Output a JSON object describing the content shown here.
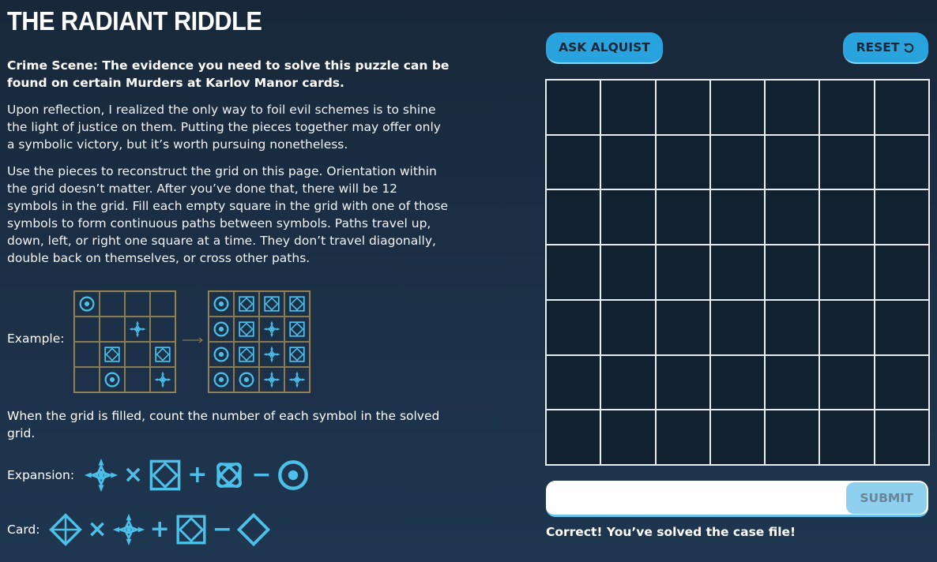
{
  "title": "THE RADIANT RIDDLE",
  "lead": "Crime Scene: The evidence you need to solve this puzzle can be found on certain Murders at Karlov Manor cards.",
  "paragraphs": [
    "Upon reflection, I realized the only way to foil evil schemes is to shine the light of justice on them. Putting the pieces together may offer only a symbolic victory, but it’s worth pursuing nonetheless.",
    "Use the pieces to reconstruct the grid on this page. Orientation within the grid doesn’t matter. After you’ve done that, there will be 12 symbols in the grid. Fill each empty square in the grid with one of those symbols to form continuous paths between symbols. Paths travel up, down, left, or right one square at a time. They don’t travel diagonally, double back on themselves, or cross other paths."
  ],
  "example": {
    "label": "Example:",
    "before": [
      [
        "dot-circle-icon",
        "",
        "",
        ""
      ],
      [
        "",
        "",
        "compass-star-icon",
        ""
      ],
      [
        "",
        "framed-diamond-icon",
        "",
        "framed-diamond-icon"
      ],
      [
        "",
        "dot-circle-icon",
        "",
        "compass-star-icon"
      ]
    ],
    "after": [
      [
        "dot-circle-icon",
        "framed-diamond-icon",
        "framed-diamond-icon",
        "framed-diamond-icon"
      ],
      [
        "dot-circle-icon",
        "framed-diamond-icon",
        "compass-star-icon",
        "framed-diamond-icon"
      ],
      [
        "dot-circle-icon",
        "framed-diamond-icon",
        "compass-star-icon",
        "framed-diamond-icon"
      ],
      [
        "dot-circle-icon",
        "dot-circle-icon",
        "compass-star-icon",
        "compass-star-icon"
      ]
    ]
  },
  "count_text": "When the grid is filled, count the number of each symbol in the solved grid.",
  "expansion": {
    "label": "Expansion:",
    "terms": [
      "compass-star-icon",
      "×",
      "framed-diamond-icon",
      "+",
      "atom-icon",
      "−",
      "dot-circle-icon"
    ]
  },
  "card": {
    "label": "Card:",
    "terms": [
      "crosshair-diamond-icon",
      "×",
      "compass-star-icon",
      "+",
      "framed-diamond-icon",
      "−",
      "outline-diamond-icon"
    ]
  },
  "buttons": {
    "ask": "ASK ALQUIST",
    "reset": "RESET",
    "submit": "SUBMIT"
  },
  "grid": {
    "rows": 7,
    "cols": 7
  },
  "answer": {
    "value": "",
    "placeholder": ""
  },
  "feedback": "Correct! You’ve solved the case file!",
  "colors": {
    "accent": "#29a3dd",
    "symbol": "#4cc0e8",
    "grid_line": "#e8edf2",
    "example_border": "#8a7a50"
  }
}
